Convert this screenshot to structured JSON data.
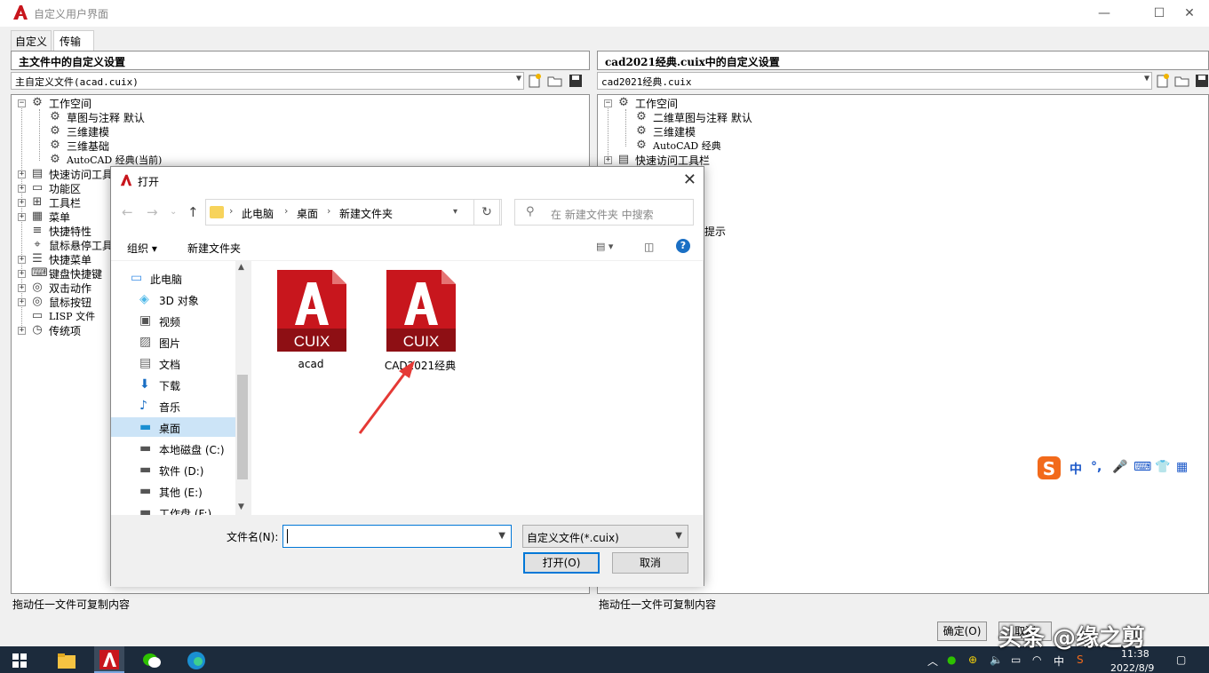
{
  "window": {
    "title": "自定义用户界面",
    "minimize": "—",
    "maximize": "☐",
    "close": "✕"
  },
  "tabs": [
    "自定义",
    "传输"
  ],
  "left_panel": {
    "header": "主文件中的自定义设置",
    "combo_value": "主自定义文件(acad.cuix)",
    "tree": [
      "工作空间",
      "草图与注释 默认",
      "三维建模",
      "三维基础",
      "AutoCAD 经典(当前)",
      "快速访问工具栏",
      "功能区",
      "工具栏",
      "菜单",
      "快捷特性",
      "鼠标悬停工具提示",
      "快捷菜单",
      "键盘快捷键",
      "双击动作",
      "鼠标按钮",
      "LISP 文件",
      "传统项"
    ],
    "status": "拖动任一文件可复制内容"
  },
  "right_panel": {
    "header": "cad2021经典.cuix中的自定义设置",
    "combo_value": "cad2021经典.cuix",
    "tree": [
      "工作空间",
      "二维草图与注释 默认",
      "三维建模",
      "AutoCAD 经典",
      "快速访问工具栏",
      "提示"
    ],
    "status": "拖动任一文件可复制内容"
  },
  "bottom_buttons": {
    "ok": "确定(O)",
    "cancel": "取消"
  },
  "dialog": {
    "title": "打开",
    "close": "✕",
    "breadcrumb": [
      "此电脑",
      "桌面",
      "新建文件夹"
    ],
    "refresh": "↻",
    "search_placeholder": "在 新建文件夹 中搜索",
    "toolbar": {
      "organize": "组织 ▾",
      "new_folder": "新建文件夹"
    },
    "nav_items": [
      {
        "label": "此电脑",
        "icon": "computer-icon"
      },
      {
        "label": "3D 对象",
        "icon": "cube-icon"
      },
      {
        "label": "视频",
        "icon": "video-icon"
      },
      {
        "label": "图片",
        "icon": "picture-icon"
      },
      {
        "label": "文档",
        "icon": "document-icon"
      },
      {
        "label": "下载",
        "icon": "download-icon"
      },
      {
        "label": "音乐",
        "icon": "music-icon"
      },
      {
        "label": "桌面",
        "icon": "desktop-icon",
        "selected": true
      },
      {
        "label": "本地磁盘 (C:)",
        "icon": "drive-icon"
      },
      {
        "label": "软件 (D:)",
        "icon": "drive-icon"
      },
      {
        "label": "其他 (E:)",
        "icon": "drive-icon"
      },
      {
        "label": "工作盘 (F:)",
        "icon": "drive-icon"
      }
    ],
    "files": [
      {
        "name": "acad",
        "badge": "CUIX"
      },
      {
        "name": "CAD2021经典",
        "badge": "CUIX"
      }
    ],
    "filename_label": "文件名(N):",
    "filename_value": "",
    "filetype": "自定义文件(*.cuix)",
    "open_button": "打开(O)",
    "cancel_button": "取消"
  },
  "ime": {
    "mode": "中"
  },
  "taskbar": {
    "tray_lang": "中",
    "time": "11:38",
    "date": "2022/8/9"
  },
  "watermark": "头条 @缘之剪",
  "colors": {
    "autocad_red": "#c8161d",
    "accent_blue": "#0078d7",
    "taskbar": "#1c2b3c"
  }
}
